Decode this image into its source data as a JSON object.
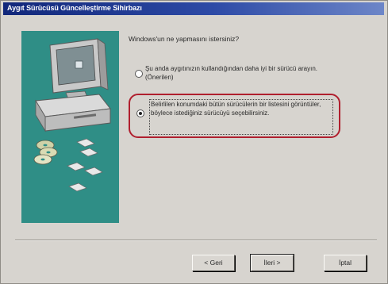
{
  "window": {
    "title": "Aygıt Sürücüsü Güncelleştirme Sihirbazı"
  },
  "content": {
    "question": "Windows'un ne yapmasını istersiniz?",
    "options": [
      {
        "label": "Şu anda aygıtınızın kullandığından daha iyi bir sürücü arayın. (Önerilen)",
        "selected": false
      },
      {
        "label": "Belirlilen konumdaki bütün sürücülerin bir listesini görüntüler, böylece istediğiniz sürücüyü seçebilirsiniz.",
        "selected": true
      }
    ]
  },
  "buttons": {
    "back": "< Geri",
    "next": "İleri >",
    "cancel": "İptal"
  },
  "colors": {
    "title_bar": "#11277a",
    "art_background": "#2f8e86",
    "highlight_ring": "#b01f2e"
  },
  "icons": [
    "computer-icon",
    "cd-disc-icon",
    "floppy-disk-icon"
  ]
}
